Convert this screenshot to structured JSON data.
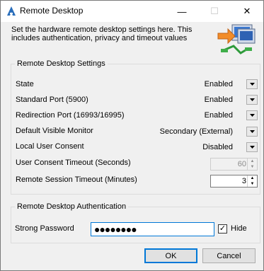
{
  "window": {
    "title": "Remote Desktop",
    "controls": {
      "minimize": "—",
      "maximize": "☐",
      "close": "✕"
    }
  },
  "header": {
    "description": "Set the hardware remote desktop settings here. This includes authentication, privacy and timeout values"
  },
  "settings": {
    "legend": "Remote Desktop Settings",
    "rows": [
      {
        "label": "State",
        "value": "Enabled"
      },
      {
        "label": "Standard Port (5900)",
        "value": "Enabled"
      },
      {
        "label": "Redirection Port (16993/16995)",
        "value": "Enabled"
      },
      {
        "label": "Default Visible Monitor",
        "value": "Secondary (External)"
      },
      {
        "label": "Local User Consent",
        "value": "Disabled"
      }
    ],
    "consent_timeout": {
      "label": "User Consent Timeout (Seconds)",
      "value": "60"
    },
    "session_timeout": {
      "label": "Remote Session Timeout (Minutes)",
      "value": "3"
    }
  },
  "auth": {
    "legend": "Remote Desktop Authentication",
    "password_label": "Strong Password",
    "password_mask": "●●●●●●●●",
    "hide_label": "Hide",
    "hide_checked": true
  },
  "buttons": {
    "ok": "OK",
    "cancel": "Cancel"
  },
  "icons": {
    "app": "remote-desktop-app-icon",
    "dropdown": "dropdown-arrow-icon",
    "header": "computer-network-icon"
  },
  "colors": {
    "accent": "#0078d7"
  }
}
